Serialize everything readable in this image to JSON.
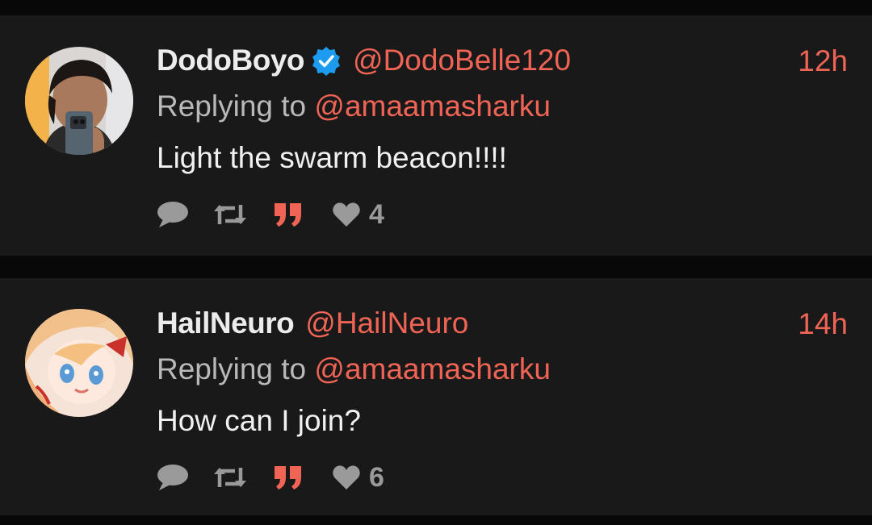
{
  "colors": {
    "background": "#080808",
    "card": "#191919",
    "accent": "#ef6455",
    "text": "#f1f1f1",
    "muted": "#b9b9b9",
    "icon": "#9a9a9a",
    "verified": "#1d9bf0"
  },
  "tweets": [
    {
      "display_name": "DodoBoyo",
      "verified": true,
      "handle": "@DodoBelle120",
      "time": "12h",
      "replying_prefix": "Replying to",
      "replying_to": "@amaamasharku",
      "text": "Light the swarm beacon!!!!",
      "like_count": "4",
      "icons": [
        "reply-icon",
        "retweet-icon",
        "quote-icon",
        "heart-icon"
      ]
    },
    {
      "display_name": "HailNeuro",
      "verified": false,
      "handle": "@HailNeuro",
      "time": "14h",
      "replying_prefix": "Replying to",
      "replying_to": "@amaamasharku",
      "text": "How can I join?",
      "like_count": "6",
      "icons": [
        "reply-icon",
        "retweet-icon",
        "quote-icon",
        "heart-icon"
      ]
    }
  ]
}
